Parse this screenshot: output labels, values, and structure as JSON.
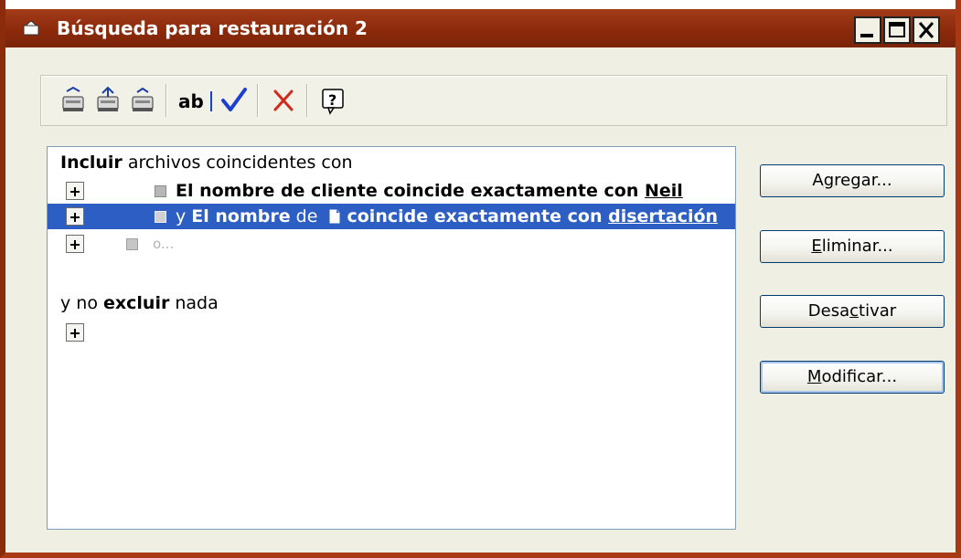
{
  "window": {
    "title": "Búsqueda para restauración 2"
  },
  "toolbar": {
    "icons": [
      "tray-icon",
      "tray-up-icon",
      "tray-icon",
      "rename-icon",
      "check-icon",
      "delete-icon",
      "help-icon"
    ]
  },
  "criteria": {
    "include_header": {
      "bold": "Incluir",
      "rest": " archivos coincidentes con"
    },
    "rows": [
      {
        "connector": "",
        "lead": "El nombre de cliente coincide exactamente con ",
        "value": "Neil"
      },
      {
        "connector": "y",
        "lead_bold": "El nombre",
        "mid": " de ",
        "tail": "coincide exactamente con ",
        "value": "disertación"
      }
    ],
    "placeholder": "o...",
    "exclude_header": {
      "pre": "y no ",
      "bold": "excluir",
      "post": " nada"
    }
  },
  "buttons": {
    "add": {
      "pre": "A",
      "mnemonic": "g",
      "post": "regar..."
    },
    "remove": {
      "pre": "",
      "mnemonic": "E",
      "post": "liminar..."
    },
    "disable": {
      "pre": "Desa",
      "mnemonic": "c",
      "post": "tivar"
    },
    "modify": {
      "pre": "",
      "mnemonic": "M",
      "post": "odificar..."
    }
  },
  "colors": {
    "titlebar": "#8c2a0b",
    "selection": "#2d5ec4",
    "check": "#1a3fd1",
    "delete": "#d12a1a"
  }
}
